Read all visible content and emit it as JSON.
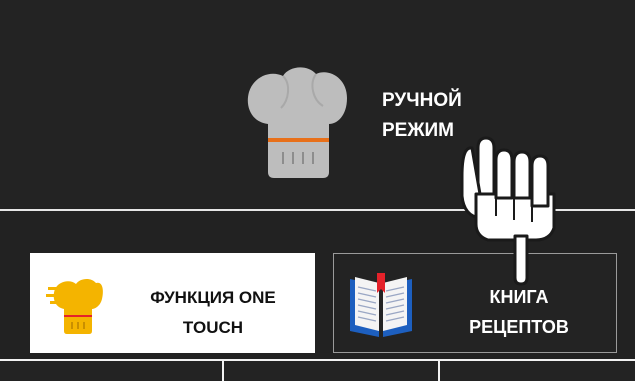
{
  "manual_mode": {
    "label_line1": "РУЧНОЙ",
    "label_line2": "РЕЖИМ",
    "icon": "chef-hat-icon"
  },
  "onetouch": {
    "label_line1": "ФУНКЦИЯ ONE",
    "label_line2": "TOUCH",
    "icon": "chef-hat-speed-icon",
    "accent_color": "#f4b400"
  },
  "recipe_book": {
    "label_line1": "КНИГА",
    "label_line2": "РЕЦЕПТОВ",
    "icon": "open-book-icon"
  },
  "pointer": {
    "icon": "hand-pointer-icon"
  },
  "colors": {
    "background": "#232323",
    "text_light": "#ffffff",
    "hat_gray": "#bdbdbd",
    "hat_band": "#e8701a",
    "book_blue": "#1d5fbf",
    "bookmark_red": "#e5222a"
  }
}
